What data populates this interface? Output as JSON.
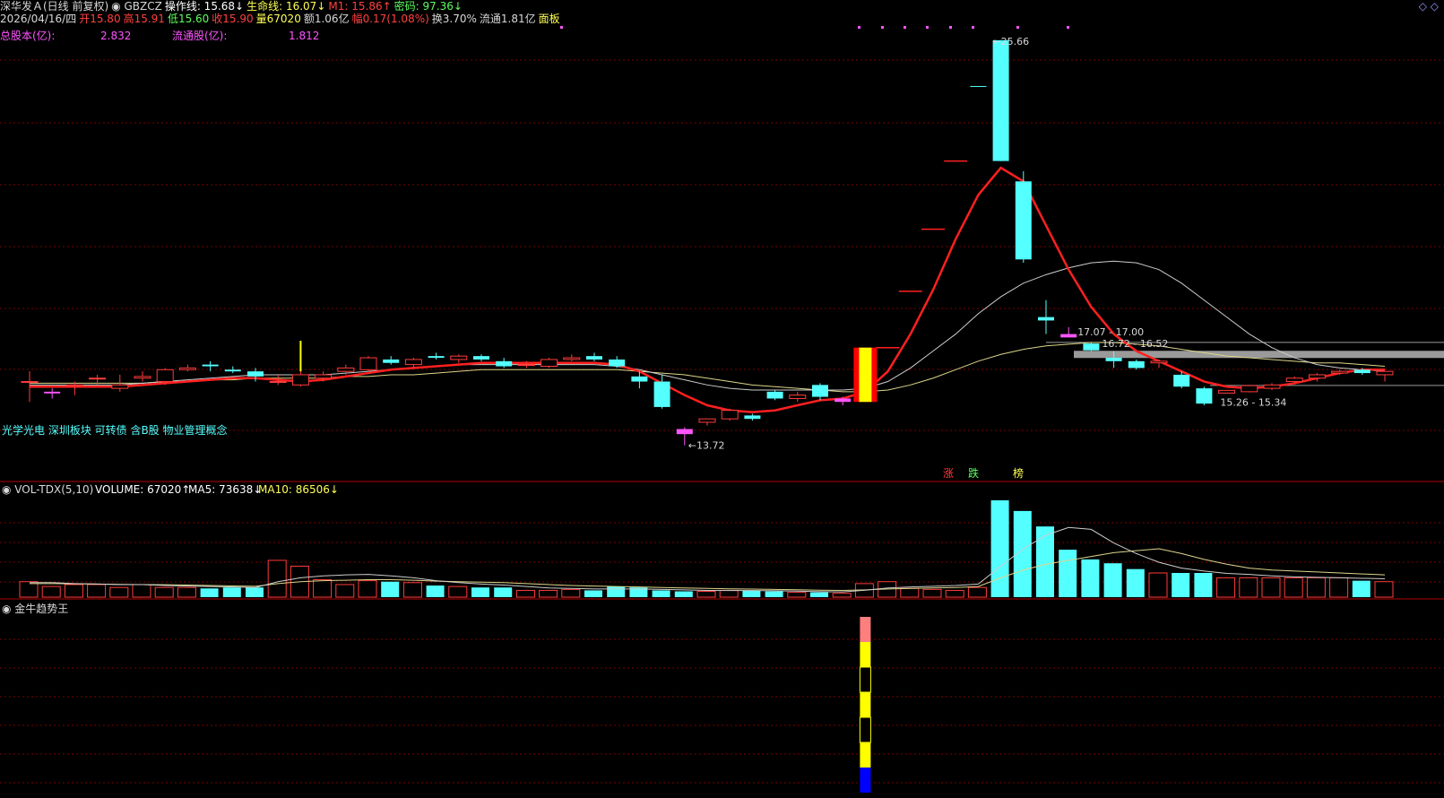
{
  "header": {
    "row1": [
      {
        "t": "深华发Ａ(日线 前复权)",
        "c": "#d8d8d8"
      },
      {
        "t": "◉ GBZCZ",
        "c": "#d8d8d8"
      },
      {
        "t": "操作线: 15.68↓",
        "c": "#ffffff"
      },
      {
        "t": "生命线: 16.07↓",
        "c": "#ffff55"
      },
      {
        "t": "M1: 15.86↑",
        "c": "#ff4040"
      },
      {
        "t": "密码: 97.36↓",
        "c": "#5cff5c"
      }
    ],
    "row2": [
      {
        "t": "2026/04/16/四",
        "c": "#d8d8d8"
      },
      {
        "t": "开15.80",
        "c": "#ff4040"
      },
      {
        "t": "高15.91",
        "c": "#ff4040"
      },
      {
        "t": "低15.60",
        "c": "#5cff5c"
      },
      {
        "t": "收15.90",
        "c": "#ff4040"
      },
      {
        "t": "量67020",
        "c": "#ffff55"
      },
      {
        "t": "额1.06亿",
        "c": "#d8d8d8"
      },
      {
        "t": "幅0.17(1.08%)",
        "c": "#ff4040"
      },
      {
        "t": "换3.70%",
        "c": "#d8d8d8"
      },
      {
        "t": "流通1.81亿",
        "c": "#d8d8d8"
      },
      {
        "t": "面板",
        "c": "#ffff55"
      }
    ],
    "row3": [
      {
        "t": "总股本(亿):",
        "c": "#ff55ff"
      },
      {
        "t": "2.832",
        "c": "#ff55ff"
      },
      {
        "t": "流通股(亿):",
        "c": "#ff55ff"
      },
      {
        "t": "1.812",
        "c": "#ff55ff"
      }
    ],
    "icons": "◇ ◇"
  },
  "concepts": "光学光电 深圳板块 可转债 含B股 物业管理概念",
  "markers": [
    "涨",
    "跌",
    "榜"
  ],
  "vol_header": [
    {
      "t": "◉ VOL-TDX(5,10)",
      "c": "#d8d8d8"
    },
    {
      "t": "VOLUME: 67020↑",
      "c": "#ffffff"
    },
    {
      "t": "MA5: 73638↓",
      "c": "#ffffff"
    },
    {
      "t": "MA10: 86506↓",
      "c": "#ffff55"
    }
  ],
  "ind_header": {
    "t": "◉ 金牛趋势王",
    "c": "#d8d8d8"
  },
  "chart_data": {
    "type": "candlestick",
    "colors": {
      "up": "#ff3c3c",
      "down": "#54ffff",
      "special": "#ff55ff",
      "ma_red": "#ff2020",
      "ma_white": "#cccccc",
      "ma_yellow": "#ddd58a",
      "grid": "#7a0000"
    },
    "price_range": [
      13.5,
      26.0
    ],
    "candles": [
      {
        "o": 15.6,
        "h": 15.9,
        "l": 15.0,
        "c": 15.6
      },
      {
        "o": 15.25,
        "h": 15.4,
        "l": 15.1,
        "c": 15.3
      },
      {
        "o": 15.5,
        "h": 15.6,
        "l": 15.2,
        "c": 15.5
      },
      {
        "o": 15.7,
        "h": 15.8,
        "l": 15.5,
        "c": 15.7
      },
      {
        "o": 15.4,
        "h": 15.8,
        "l": 15.3,
        "c": 15.5
      },
      {
        "o": 15.7,
        "h": 15.9,
        "l": 15.6,
        "c": 15.75
      },
      {
        "o": 15.6,
        "h": 16.0,
        "l": 15.5,
        "c": 15.95
      },
      {
        "o": 15.95,
        "h": 16.1,
        "l": 15.9,
        "c": 16.0
      },
      {
        "o": 16.1,
        "h": 16.2,
        "l": 15.9,
        "c": 16.05
      },
      {
        "o": 15.95,
        "h": 16.05,
        "l": 15.85,
        "c": 15.9
      },
      {
        "o": 15.9,
        "h": 16.0,
        "l": 15.6,
        "c": 15.75
      },
      {
        "o": 15.6,
        "h": 15.8,
        "l": 15.5,
        "c": 15.6
      },
      {
        "o": 15.5,
        "h": 16.8,
        "l": 15.45,
        "c": 15.8
      },
      {
        "o": 15.7,
        "h": 15.9,
        "l": 15.6,
        "c": 15.8
      },
      {
        "o": 15.9,
        "h": 16.1,
        "l": 15.8,
        "c": 16.0
      },
      {
        "o": 15.95,
        "h": 16.35,
        "l": 15.9,
        "c": 16.3
      },
      {
        "o": 16.25,
        "h": 16.35,
        "l": 16.1,
        "c": 16.15
      },
      {
        "o": 16.1,
        "h": 16.3,
        "l": 16.0,
        "c": 16.25
      },
      {
        "o": 16.35,
        "h": 16.45,
        "l": 16.25,
        "c": 16.3
      },
      {
        "o": 16.25,
        "h": 16.4,
        "l": 16.15,
        "c": 16.35
      },
      {
        "o": 16.35,
        "h": 16.4,
        "l": 16.2,
        "c": 16.25
      },
      {
        "o": 16.2,
        "h": 16.3,
        "l": 16.0,
        "c": 16.05
      },
      {
        "o": 16.1,
        "h": 16.2,
        "l": 16.0,
        "c": 16.1
      },
      {
        "o": 16.05,
        "h": 16.3,
        "l": 16.0,
        "c": 16.25
      },
      {
        "o": 16.25,
        "h": 16.4,
        "l": 16.2,
        "c": 16.3
      },
      {
        "o": 16.35,
        "h": 16.45,
        "l": 16.2,
        "c": 16.25
      },
      {
        "o": 16.25,
        "h": 16.35,
        "l": 16.0,
        "c": 16.05
      },
      {
        "o": 15.75,
        "h": 15.9,
        "l": 15.4,
        "c": 15.6
      },
      {
        "o": 15.6,
        "h": 15.8,
        "l": 14.8,
        "c": 14.85
      },
      {
        "o": 14.2,
        "h": 14.25,
        "l": 13.72,
        "c": 14.05
      },
      {
        "o": 14.4,
        "h": 14.5,
        "l": 14.3,
        "c": 14.5
      },
      {
        "o": 14.5,
        "h": 14.8,
        "l": 14.45,
        "c": 14.75
      },
      {
        "o": 14.6,
        "h": 14.65,
        "l": 14.45,
        "c": 14.5
      },
      {
        "o": 15.3,
        "h": 15.35,
        "l": 15.05,
        "c": 15.1
      },
      {
        "o": 15.1,
        "h": 15.3,
        "l": 15.0,
        "c": 15.2
      },
      {
        "o": 15.5,
        "h": 15.55,
        "l": 15.05,
        "c": 15.15
      },
      {
        "o": 15.0,
        "h": 15.15,
        "l": 14.9,
        "c": 15.1
      },
      {
        "o": 15.0,
        "h": 16.6,
        "l": 15.0,
        "c": 16.6
      },
      {
        "o": 16.6,
        "h": 16.6,
        "l": 16.6,
        "c": 16.6
      },
      {
        "o": 18.26,
        "h": 18.26,
        "l": 18.26,
        "c": 18.26
      },
      {
        "o": 20.09,
        "h": 20.09,
        "l": 20.09,
        "c": 20.09
      },
      {
        "o": 22.1,
        "h": 22.1,
        "l": 22.1,
        "c": 22.1
      },
      {
        "o": 24.31,
        "h": 24.31,
        "l": 24.31,
        "c": 24.31
      },
      {
        "o": 25.66,
        "h": 25.66,
        "l": 22.1,
        "c": 22.1
      },
      {
        "o": 21.5,
        "h": 21.8,
        "l": 19.1,
        "c": 19.2
      },
      {
        "o": 17.5,
        "h": 18.0,
        "l": 17.0,
        "c": 17.4
      },
      {
        "o": 17.0,
        "h": 17.2,
        "l": 16.9,
        "c": 16.9
      },
      {
        "o": 16.72,
        "h": 16.75,
        "l": 16.5,
        "c": 16.52
      },
      {
        "o": 16.3,
        "h": 16.5,
        "l": 16.0,
        "c": 16.2
      },
      {
        "o": 16.2,
        "h": 16.25,
        "l": 15.95,
        "c": 16.0
      },
      {
        "o": 16.15,
        "h": 16.25,
        "l": 16.0,
        "c": 16.2
      },
      {
        "o": 15.8,
        "h": 15.9,
        "l": 15.4,
        "c": 15.45
      },
      {
        "o": 15.4,
        "h": 15.45,
        "l": 14.9,
        "c": 14.95
      },
      {
        "o": 15.26,
        "h": 15.34,
        "l": 15.26,
        "c": 15.34
      },
      {
        "o": 15.3,
        "h": 15.5,
        "l": 15.28,
        "c": 15.48
      },
      {
        "o": 15.4,
        "h": 15.55,
        "l": 15.35,
        "c": 15.5
      },
      {
        "o": 15.6,
        "h": 15.75,
        "l": 15.55,
        "c": 15.7
      },
      {
        "o": 15.7,
        "h": 15.85,
        "l": 15.6,
        "c": 15.8
      },
      {
        "o": 15.85,
        "h": 15.95,
        "l": 15.8,
        "c": 15.9
      },
      {
        "o": 15.95,
        "h": 16.0,
        "l": 15.8,
        "c": 15.85
      },
      {
        "o": 15.8,
        "h": 15.91,
        "l": 15.6,
        "c": 15.9
      }
    ],
    "special_idx": [
      1,
      29,
      36,
      46
    ],
    "limit_up_idx": [
      37
    ],
    "ma_red": [
      15.45,
      15.45,
      15.45,
      15.45,
      15.45,
      15.5,
      15.55,
      15.6,
      15.65,
      15.7,
      15.7,
      15.65,
      15.6,
      15.65,
      15.75,
      15.85,
      15.95,
      16.0,
      16.05,
      16.1,
      16.15,
      16.15,
      16.15,
      16.15,
      16.15,
      16.15,
      16.1,
      15.9,
      15.55,
      15.2,
      14.9,
      14.75,
      14.7,
      14.75,
      14.9,
      15.05,
      15.1,
      15.3,
      15.9,
      17.0,
      18.3,
      19.8,
      21.1,
      21.9,
      21.5,
      20.2,
      18.9,
      17.8,
      17.0,
      16.5,
      16.2,
      15.9,
      15.6,
      15.45,
      15.4,
      15.45,
      15.55,
      15.7,
      15.85,
      15.95,
      15.95
    ],
    "ma_white": [
      15.5,
      15.5,
      15.5,
      15.5,
      15.5,
      15.55,
      15.6,
      15.65,
      15.7,
      15.75,
      15.8,
      15.8,
      15.8,
      15.8,
      15.85,
      15.9,
      15.95,
      16.0,
      16.05,
      16.1,
      16.1,
      16.1,
      16.1,
      16.1,
      16.1,
      16.1,
      16.05,
      15.95,
      15.8,
      15.65,
      15.5,
      15.4,
      15.35,
      15.35,
      15.35,
      15.35,
      15.35,
      15.4,
      15.6,
      16.0,
      16.5,
      17.0,
      17.6,
      18.1,
      18.5,
      18.75,
      18.95,
      19.1,
      19.15,
      19.1,
      18.9,
      18.5,
      18.0,
      17.5,
      17.0,
      16.6,
      16.3,
      16.1,
      16.0,
      15.95,
      15.9
    ],
    "ma_yellow": [
      15.55,
      15.55,
      15.55,
      15.55,
      15.55,
      15.55,
      15.6,
      15.6,
      15.65,
      15.65,
      15.7,
      15.7,
      15.7,
      15.7,
      15.75,
      15.75,
      15.8,
      15.8,
      15.85,
      15.9,
      15.95,
      15.95,
      15.95,
      15.95,
      15.95,
      15.95,
      15.95,
      15.9,
      15.85,
      15.8,
      15.7,
      15.6,
      15.5,
      15.45,
      15.4,
      15.35,
      15.3,
      15.3,
      15.35,
      15.5,
      15.7,
      15.95,
      16.2,
      16.4,
      16.55,
      16.65,
      16.7,
      16.75,
      16.75,
      16.7,
      16.65,
      16.55,
      16.45,
      16.35,
      16.3,
      16.25,
      16.2,
      16.15,
      16.15,
      16.1,
      16.05
    ],
    "zones": [
      {
        "label": "17.07 - 17.00",
        "v": 17.0
      },
      {
        "label": "16.72 - 16.52",
        "v": 16.52
      }
    ],
    "zone_bars": [
      16.4,
      15.3
    ],
    "annotations": [
      {
        "label": "25.66",
        "idx": 42,
        "v": 25.66
      },
      {
        "label": "13.72",
        "idx": 29,
        "v": 13.72
      },
      {
        "label": "15.26 - 15.34",
        "idx": 52,
        "v": 15.26
      }
    ],
    "volume": {
      "range": [
        0,
        100000
      ],
      "values": [
        16000,
        11000,
        13000,
        13000,
        10000,
        13000,
        10000,
        10000,
        9000,
        10000,
        10000,
        38000,
        32000,
        18000,
        13000,
        17000,
        16000,
        15000,
        12000,
        11000,
        10000,
        10000,
        7000,
        7000,
        8000,
        7000,
        11000,
        10000,
        7000,
        6000,
        6000,
        7000,
        7000,
        6000,
        5000,
        5000,
        4000,
        14000,
        16000,
        9000,
        8000,
        7000,
        10000,
        100000,
        89000,
        73000,
        49000,
        39000,
        35000,
        29000,
        25000,
        25000,
        25000,
        20000,
        20000,
        20000,
        20000,
        20000,
        20000,
        17000,
        16000
      ],
      "ma5": [
        15000,
        15000,
        14000,
        13500,
        13000,
        13000,
        12000,
        11500,
        11000,
        10500,
        10000,
        16000,
        20000,
        22000,
        23000,
        23500,
        22000,
        20000,
        17000,
        15000,
        13500,
        12500,
        11000,
        9500,
        9000,
        8500,
        8500,
        8500,
        8000,
        7500,
        7000,
        6800,
        6800,
        6600,
        6200,
        5700,
        5400,
        7200,
        9500,
        10500,
        11200,
        12000,
        13500,
        32000,
        50000,
        64000,
        72000,
        70000,
        56000,
        45000,
        36000,
        30000,
        27000,
        24500,
        23500,
        22000,
        21000,
        20500,
        20000,
        19500,
        19000
      ],
      "ma10": [
        14000,
        14000,
        13800,
        13500,
        13200,
        13000,
        12800,
        12500,
        12000,
        11600,
        11200,
        14000,
        16000,
        17000,
        17500,
        18000,
        18000,
        17500,
        16500,
        16000,
        15500,
        15000,
        14000,
        13000,
        12000,
        11500,
        11000,
        10500,
        10000,
        9500,
        9000,
        8600,
        8300,
        8000,
        7600,
        7200,
        6900,
        7500,
        8500,
        9000,
        9500,
        10000,
        11000,
        20000,
        28000,
        34000,
        38000,
        42000,
        46000,
        48000,
        50000,
        45000,
        39000,
        34000,
        30000,
        28000,
        27000,
        26000,
        25000,
        24000,
        23000
      ]
    },
    "indicator": {
      "bar_idx": 37,
      "segments": [
        {
          "c": "#ff7f7f",
          "v": 1
        },
        {
          "c": "#ffff00",
          "v": 1
        },
        {
          "c": "#000000",
          "v": 1
        },
        {
          "c": "#ffff00",
          "v": 1
        },
        {
          "c": "#000000",
          "v": 1
        },
        {
          "c": "#ffff00",
          "v": 1
        },
        {
          "c": "#0000ff",
          "v": 1
        }
      ]
    }
  }
}
